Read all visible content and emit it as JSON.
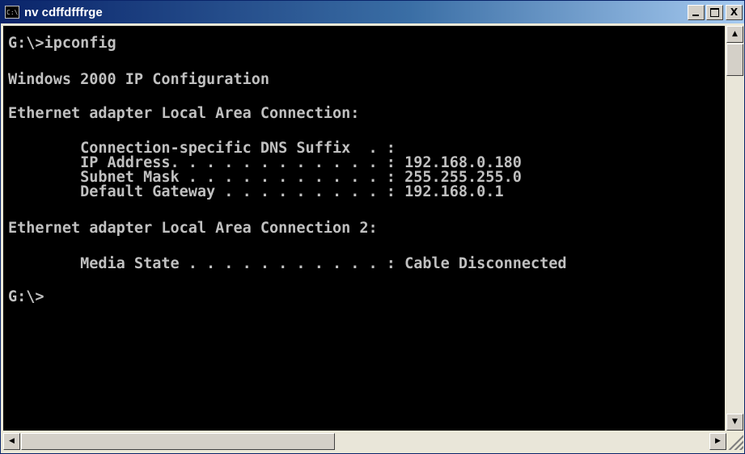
{
  "window": {
    "icon_text": "C:\\",
    "title": "nv cdffdfffrge",
    "minimize_label": "",
    "maximize_label": "",
    "close_label": "X"
  },
  "console": {
    "lines": [
      "G:\\>ipconfig",
      "Windows 2000 IP Configuration",
      "Ethernet adapter Local Area Connection:",
      "        Connection-specific DNS Suffix  . :",
      "        IP Address. . . . . . . . . . . . : 192.168.0.180",
      "        Subnet Mask . . . . . . . . . . . : 255.255.255.0",
      "        Default Gateway . . . . . . . . . : 192.168.0.1",
      "Ethernet adapter Local Area Connection 2:",
      "        Media State . . . . . . . . . . . : Cable Disconnected",
      "G:\\>"
    ]
  },
  "scrollbars": {
    "up_arrow": "▲",
    "down_arrow": "▼",
    "left_arrow": "◀",
    "right_arrow": "▶"
  }
}
